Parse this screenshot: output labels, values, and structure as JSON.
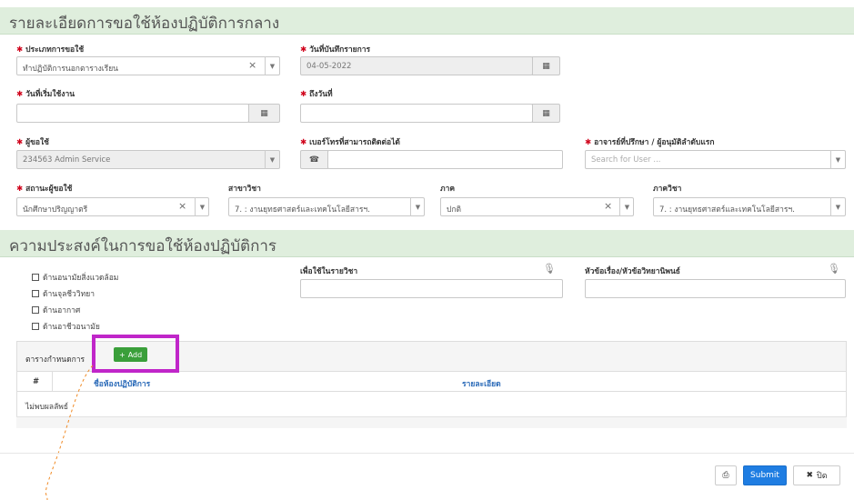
{
  "section1": {
    "title": "รายละเอียดการขอใช้ห้องปฏิบัติการกลาง"
  },
  "fields": {
    "request_type": {
      "label": "ประเภทการขอใช้",
      "value": "ทำปฏิบัติการนอกตารางเรียน"
    },
    "record_date": {
      "label": "วันที่บันทึกรายการ",
      "value": "04-05-2022"
    },
    "start_date": {
      "label": "วันที่เริ่มใช้งาน",
      "value": ""
    },
    "end_date": {
      "label": "ถึงวันที่",
      "value": ""
    },
    "requester": {
      "label": "ผู้ขอใช้",
      "value": "234563 Admin Service"
    },
    "phone": {
      "label": "เบอร์โทรที่สามารถติดต่อได้",
      "value": ""
    },
    "advisor": {
      "label": "อาจารย์ที่ปรึกษา / ผู้อนุมัติลำดับแรก",
      "placeholder": "Search for User ..."
    },
    "status": {
      "label": "สถานะผู้ขอใช้",
      "value": "นักศึกษาปริญญาตรี"
    },
    "program": {
      "label": "สาขาวิชา",
      "value": "7. : งานยุทธศาสตร์และเทคโนโลยีสารฯ."
    },
    "term": {
      "label": "ภาค",
      "value": "ปกติ"
    },
    "department": {
      "label": "ภาควิชา",
      "value": "7. : งานยุทธศาสตร์และเทคโนโลยีสารฯ."
    }
  },
  "section2": {
    "title": "ความประสงค์ในการขอใช้ห้องปฏิบัติการ"
  },
  "checkboxes": [
    {
      "label": "ด้านอนามัยสิ่งแวดล้อม"
    },
    {
      "label": "ด้านจุลชีววิทยา"
    },
    {
      "label": "ด้านอากาศ"
    },
    {
      "label": "ด้านอาชีวอนามัย"
    }
  ],
  "course_field": {
    "label": "เพื่อใช้ในรายวิชา",
    "value": ""
  },
  "thesis_field": {
    "label": "หัวข้อเรื่อง/หัวข้อวิทยานิพนธ์",
    "value": ""
  },
  "schedule": {
    "title": "ตารางกำหนดการ",
    "add_label": "Add",
    "columns": {
      "num": "#",
      "room": "ชื่อห้องปฏิบัติการ",
      "detail": "รายละเอียด"
    },
    "empty_text": "ไม่พบผลลัพธ์"
  },
  "footer": {
    "submit_label": "Submit",
    "close_label": "ปิด"
  },
  "colors": {
    "section_bg": "#dfeedd",
    "primary": "#1f7de2",
    "add_green": "#3a9f3a",
    "highlight": "#c026c9",
    "required": "#d0021b",
    "arrow": "#f08a24"
  }
}
